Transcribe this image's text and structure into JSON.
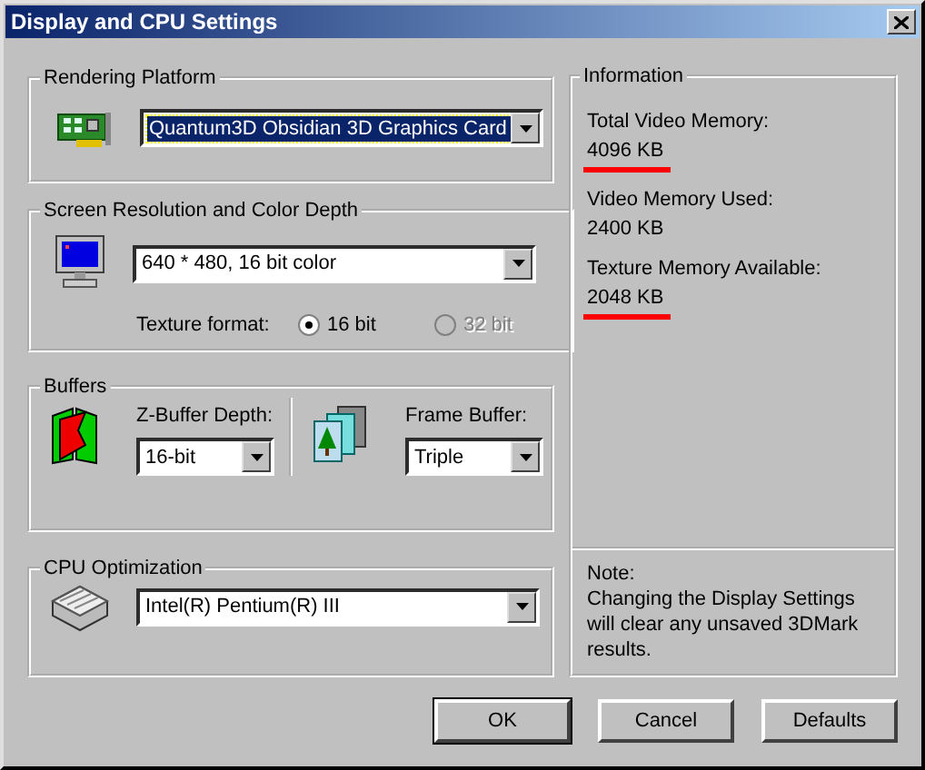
{
  "window": {
    "title": "Display and CPU Settings"
  },
  "rendering_platform": {
    "label": "Rendering Platform",
    "value": "Quantum3D Obsidian 3D Graphics Card",
    "focused": true
  },
  "screen_resolution": {
    "label": "Screen Resolution and Color Depth",
    "value": "640 * 480, 16 bit color",
    "focused": false,
    "texture_format": {
      "label": "Texture format:",
      "options": [
        {
          "label": "16 bit",
          "selected": true,
          "disabled": false
        },
        {
          "label": "32 bit",
          "selected": false,
          "disabled": true
        }
      ]
    }
  },
  "buffers": {
    "label": "Buffers",
    "z_buffer": {
      "label": "Z-Buffer Depth:",
      "value": "16-bit"
    },
    "frame_buffer": {
      "label": "Frame Buffer:",
      "value": "Triple"
    }
  },
  "cpu_optimization": {
    "label": "CPU Optimization",
    "value": "Intel(R) Pentium(R) III",
    "focused": false
  },
  "information": {
    "label": "Information",
    "items": [
      {
        "label": "Total Video Memory:",
        "value": "4096 KB",
        "underlined": true
      },
      {
        "label": "Video Memory Used:",
        "value": "2400 KB",
        "underlined": false
      },
      {
        "label": "Texture Memory Available:",
        "value": "2048 KB",
        "underlined": true
      }
    ],
    "note": {
      "heading": "Note:",
      "text": "Changing the Display Settings will clear any unsaved 3DMark results."
    }
  },
  "buttons": [
    {
      "label": "OK",
      "default": true
    },
    {
      "label": "Cancel",
      "default": false
    },
    {
      "label": "Defaults",
      "default": false
    }
  ]
}
